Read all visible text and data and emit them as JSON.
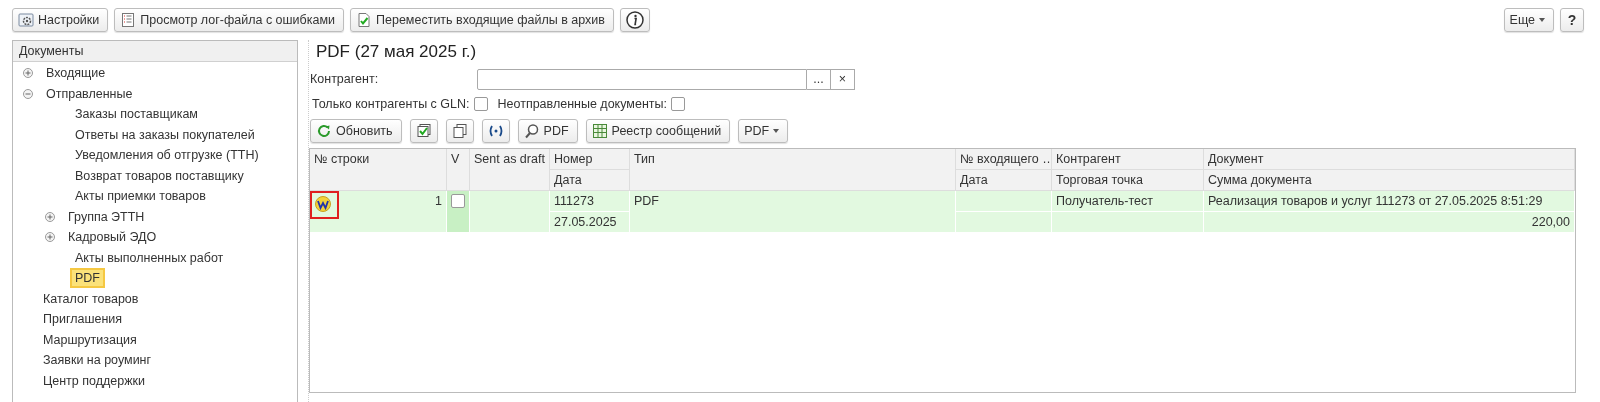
{
  "toolbar": {
    "buttons": [
      {
        "label": "Настройки"
      },
      {
        "label": "Просмотр лог-файла с ошибками"
      },
      {
        "label": "Переместить входящие файлы в архив"
      }
    ],
    "more": "Еще",
    "help": "?"
  },
  "sidebar": {
    "title": "Документы",
    "items": [
      {
        "label": "Входящие",
        "expanded": false,
        "selected": false
      },
      {
        "label": "Отправленные",
        "expanded": true,
        "selected": false,
        "children": [
          {
            "label": "Заказы поставщикам",
            "selected": false
          },
          {
            "label": "Ответы на заказы покупателей",
            "selected": false
          },
          {
            "label": "Уведомления об отгрузке (ТТН)",
            "selected": false
          },
          {
            "label": "Возврат товаров поставщику",
            "selected": false
          },
          {
            "label": "Акты приемки товаров",
            "selected": false
          },
          {
            "label": "Группа ЭТТН",
            "selected": false,
            "expanded": false
          },
          {
            "label": "Кадровый ЭДО",
            "selected": false,
            "expanded": false
          },
          {
            "label": "Акты выполненных работ",
            "selected": false
          },
          {
            "label": "PDF",
            "selected": true
          }
        ]
      },
      {
        "label": "Каталог товаров",
        "selected": false
      },
      {
        "label": "Приглашения",
        "selected": false
      },
      {
        "label": "Маршрутизация",
        "selected": false
      },
      {
        "label": "Заявки на роуминг",
        "selected": false
      },
      {
        "label": "Центр поддержки",
        "selected": false
      }
    ]
  },
  "main": {
    "title": "PDF (27 мая 2025 г.)",
    "filter": {
      "label": "Контрагент:",
      "choose": "...",
      "clear": "×"
    },
    "options": [
      {
        "label": "Только контрагенты с GLN:",
        "checked": false
      },
      {
        "label": "Неотправленные документы:",
        "checked": false
      }
    ],
    "actions": [
      {
        "label": "Обновить"
      },
      {
        "label": "PDF"
      },
      {
        "label": "Реестр сообщений"
      }
    ],
    "dropdown": "PDF",
    "table": {
      "columns": [
        {
          "label": "№ строки"
        },
        {
          "label": "V"
        },
        {
          "label": "Sent as draft"
        },
        {
          "label": "Номер",
          "sub": "Дата"
        },
        {
          "label": "Тип"
        },
        {
          "label": "№ входящего …",
          "sub": "Дата"
        },
        {
          "label": "Контрагент",
          "sub": "Торговая точка"
        },
        {
          "label": "Документ",
          "sub": "Сумма документа"
        }
      ],
      "rows": [
        {
          "selected": true,
          "line": "1",
          "checked": false,
          "number": "111273",
          "date": "27.05.2025",
          "type": "PDF",
          "counterparty": "Получатель-тест",
          "document": "Реализация товаров и услуг 111273 от 27.05.2025 8:51:29",
          "sum": "220,00"
        }
      ]
    }
  }
}
